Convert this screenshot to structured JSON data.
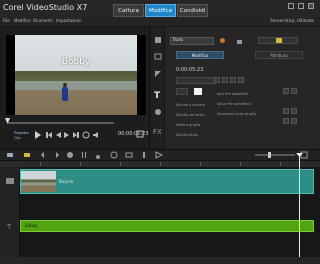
{
  "app": {
    "title": "Corel VideoStudio X7"
  },
  "tabs": [
    {
      "label": "Cattura",
      "active": false
    },
    {
      "label": "Modifica",
      "active": true
    },
    {
      "label": "Condividi",
      "active": false
    }
  ],
  "menu": {
    "items": [
      "File",
      "Modifica",
      "Strumenti",
      "Impostazioni"
    ],
    "scope": "Sensoristica, Ultimate"
  },
  "player": {
    "caption": "Bobby",
    "project_label": "Progetto",
    "clip_label": "Clip",
    "timecode": "00:00:05:23"
  },
  "options": {
    "font": "Titolo",
    "tab_edit": "Modifica",
    "tab_attribute": "Attributo",
    "duration": "0:00:05:23",
    "labels": [
      "Allinea a sinistra",
      "Sfondo del testo",
      "Mostra griglia",
      "Allinea titolo"
    ],
    "actions": [
      "Apri file sottotitoli",
      "Salva file sottotitoli",
      "Visualizza linee griglia"
    ]
  },
  "timeline": {
    "video_clip_name": "Bicycle",
    "title_clip_name": "Bobby"
  },
  "colors": {
    "accent": "#1f86c9",
    "video_clip": "#2e8e86",
    "title_clip": "#51a30f"
  }
}
